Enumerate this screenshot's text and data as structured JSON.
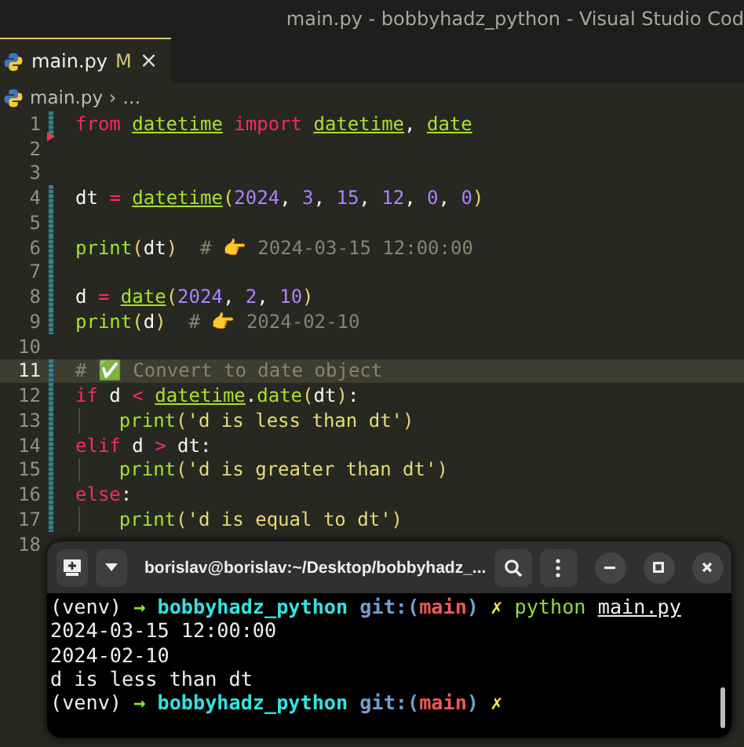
{
  "window": {
    "title": "main.py - bobbyhadz_python - Visual Studio Cod"
  },
  "tabs": [
    {
      "label": "main.py",
      "badge": "M",
      "close": "×",
      "selected": true
    }
  ],
  "breadcrumb": {
    "file": "main.py",
    "separator": "›",
    "rest": "…"
  },
  "lines": [
    {
      "number": "1",
      "modified": true,
      "deleted": false,
      "current": false,
      "indent_guide": false,
      "tokens": [
        {
          "text": "from ",
          "kind": "keyword"
        },
        {
          "text": "datetime",
          "kind": "module"
        },
        {
          "text": " import ",
          "kind": "keyword"
        },
        {
          "text": "datetime",
          "kind": "module"
        },
        {
          "text": ", ",
          "kind": "plain"
        },
        {
          "text": "date",
          "kind": "module"
        }
      ]
    },
    {
      "number": "2",
      "modified": false,
      "deleted": true,
      "current": false,
      "indent_guide": false
    },
    {
      "number": "3",
      "modified": false,
      "deleted": false,
      "current": false,
      "indent_guide": false
    },
    {
      "number": "4",
      "modified": true,
      "deleted": false,
      "current": false,
      "indent_guide": false,
      "tokens": [
        {
          "text": "dt ",
          "kind": "plain"
        },
        {
          "text": "= ",
          "kind": "operator"
        },
        {
          "text": "datetime",
          "kind": "module"
        },
        {
          "text": "(",
          "kind": "bracket"
        },
        {
          "text": "2024",
          "kind": "number"
        },
        {
          "text": ", ",
          "kind": "plain"
        },
        {
          "text": "3",
          "kind": "number"
        },
        {
          "text": ", ",
          "kind": "plain"
        },
        {
          "text": "15",
          "kind": "number"
        },
        {
          "text": ", ",
          "kind": "plain"
        },
        {
          "text": "12",
          "kind": "number"
        },
        {
          "text": ", ",
          "kind": "plain"
        },
        {
          "text": "0",
          "kind": "number"
        },
        {
          "text": ", ",
          "kind": "plain"
        },
        {
          "text": "0",
          "kind": "number"
        },
        {
          "text": ")",
          "kind": "bracket"
        }
      ]
    },
    {
      "number": "5",
      "modified": true,
      "deleted": false,
      "current": false,
      "indent_guide": false
    },
    {
      "number": "6",
      "modified": true,
      "deleted": false,
      "current": false,
      "indent_guide": false,
      "tokens": [
        {
          "text": "print",
          "kind": "function"
        },
        {
          "text": "(",
          "kind": "bracket"
        },
        {
          "text": "dt",
          "kind": "plain"
        },
        {
          "text": ")",
          "kind": "bracket"
        },
        {
          "text": "  # 👉 2024-03-15 12:00:00",
          "kind": "comment"
        }
      ]
    },
    {
      "number": "7",
      "modified": true,
      "deleted": false,
      "current": false,
      "indent_guide": false
    },
    {
      "number": "8",
      "modified": true,
      "deleted": false,
      "current": false,
      "indent_guide": false,
      "tokens": [
        {
          "text": "d ",
          "kind": "plain"
        },
        {
          "text": "= ",
          "kind": "operator"
        },
        {
          "text": "date",
          "kind": "module"
        },
        {
          "text": "(",
          "kind": "bracket"
        },
        {
          "text": "2024",
          "kind": "number"
        },
        {
          "text": ", ",
          "kind": "plain"
        },
        {
          "text": "2",
          "kind": "number"
        },
        {
          "text": ", ",
          "kind": "plain"
        },
        {
          "text": "10",
          "kind": "number"
        },
        {
          "text": ")",
          "kind": "bracket"
        }
      ]
    },
    {
      "number": "9",
      "modified": true,
      "deleted": false,
      "current": false,
      "indent_guide": false,
      "tokens": [
        {
          "text": "print",
          "kind": "function"
        },
        {
          "text": "(",
          "kind": "bracket"
        },
        {
          "text": "d",
          "kind": "plain"
        },
        {
          "text": ")",
          "kind": "bracket"
        },
        {
          "text": "  # 👉 2024-02-10",
          "kind": "comment"
        }
      ]
    },
    {
      "number": "10",
      "modified": false,
      "deleted": false,
      "current": false,
      "indent_guide": false
    },
    {
      "number": "11",
      "modified": true,
      "deleted": false,
      "current": true,
      "indent_guide": false,
      "tokens": [
        {
          "text": "# ✅ Convert to date object",
          "kind": "comment"
        }
      ]
    },
    {
      "number": "12",
      "modified": true,
      "deleted": false,
      "current": false,
      "indent_guide": false,
      "tokens": [
        {
          "text": "if",
          "kind": "keyword"
        },
        {
          "text": " d ",
          "kind": "plain"
        },
        {
          "text": "< ",
          "kind": "operator"
        },
        {
          "text": "datetime",
          "kind": "module"
        },
        {
          "text": ".",
          "kind": "plain"
        },
        {
          "text": "date",
          "kind": "function"
        },
        {
          "text": "(",
          "kind": "bracket"
        },
        {
          "text": "dt",
          "kind": "plain"
        },
        {
          "text": ")",
          "kind": "bracket"
        },
        {
          "text": ":",
          "kind": "plain"
        }
      ]
    },
    {
      "number": "13",
      "modified": true,
      "deleted": false,
      "current": false,
      "indent_guide": true,
      "tokens": [
        {
          "text": "print",
          "kind": "function"
        },
        {
          "text": "(",
          "kind": "bracket"
        },
        {
          "text": "'d is less than dt'",
          "kind": "string"
        },
        {
          "text": ")",
          "kind": "bracket"
        }
      ]
    },
    {
      "number": "14",
      "modified": true,
      "deleted": false,
      "current": false,
      "indent_guide": false,
      "tokens": [
        {
          "text": "elif",
          "kind": "keyword"
        },
        {
          "text": " d ",
          "kind": "plain"
        },
        {
          "text": ">",
          "kind": "operator"
        },
        {
          "text": " dt:",
          "kind": "plain"
        }
      ]
    },
    {
      "number": "15",
      "modified": true,
      "deleted": false,
      "current": false,
      "indent_guide": true,
      "tokens": [
        {
          "text": "print",
          "kind": "function"
        },
        {
          "text": "(",
          "kind": "bracket"
        },
        {
          "text": "'d is greater than dt'",
          "kind": "string"
        },
        {
          "text": ")",
          "kind": "bracket"
        }
      ]
    },
    {
      "number": "16",
      "modified": true,
      "deleted": false,
      "current": false,
      "indent_guide": false,
      "tokens": [
        {
          "text": "else",
          "kind": "keyword"
        },
        {
          "text": ":",
          "kind": "plain"
        }
      ]
    },
    {
      "number": "17",
      "modified": true,
      "deleted": false,
      "current": false,
      "indent_guide": true,
      "tokens": [
        {
          "text": "print",
          "kind": "function"
        },
        {
          "text": "(",
          "kind": "bracket"
        },
        {
          "text": "'d is equal to dt'",
          "kind": "string"
        },
        {
          "text": ")",
          "kind": "bracket"
        }
      ]
    },
    {
      "number": "18",
      "modified": false,
      "deleted": false,
      "current": false,
      "indent_guide": false
    }
  ],
  "terminal": {
    "title": "borislav@borislav:~/Desktop/bobbyhadz_...",
    "lines": [
      {
        "tokens": [
          {
            "text": "(venv) ",
            "kind": "plain"
          },
          {
            "text": "→ ",
            "kind": "arrow"
          },
          {
            "text": "bobbyhadz_python",
            "kind": "dir"
          },
          {
            "text": " git:(",
            "kind": "git"
          },
          {
            "text": "main",
            "kind": "branch"
          },
          {
            "text": ")",
            "kind": "git"
          },
          {
            "text": " ✗",
            "kind": "dirty"
          },
          {
            "text": " python ",
            "kind": "command"
          },
          {
            "text": "main.py",
            "kind": "path"
          }
        ]
      },
      {
        "tokens": [
          {
            "text": "2024-03-15 12:00:00",
            "kind": "plain"
          }
        ]
      },
      {
        "tokens": [
          {
            "text": "2024-02-10",
            "kind": "plain"
          }
        ]
      },
      {
        "tokens": [
          {
            "text": "d is less than dt",
            "kind": "plain"
          }
        ]
      },
      {
        "tokens": [
          {
            "text": "(venv) ",
            "kind": "plain"
          },
          {
            "text": "→ ",
            "kind": "arrow"
          },
          {
            "text": "bobbyhadz_python",
            "kind": "dir"
          },
          {
            "text": " git:(",
            "kind": "git"
          },
          {
            "text": "main",
            "kind": "branch"
          },
          {
            "text": ")",
            "kind": "git"
          },
          {
            "text": " ✗",
            "kind": "dirty"
          }
        ]
      }
    ]
  }
}
